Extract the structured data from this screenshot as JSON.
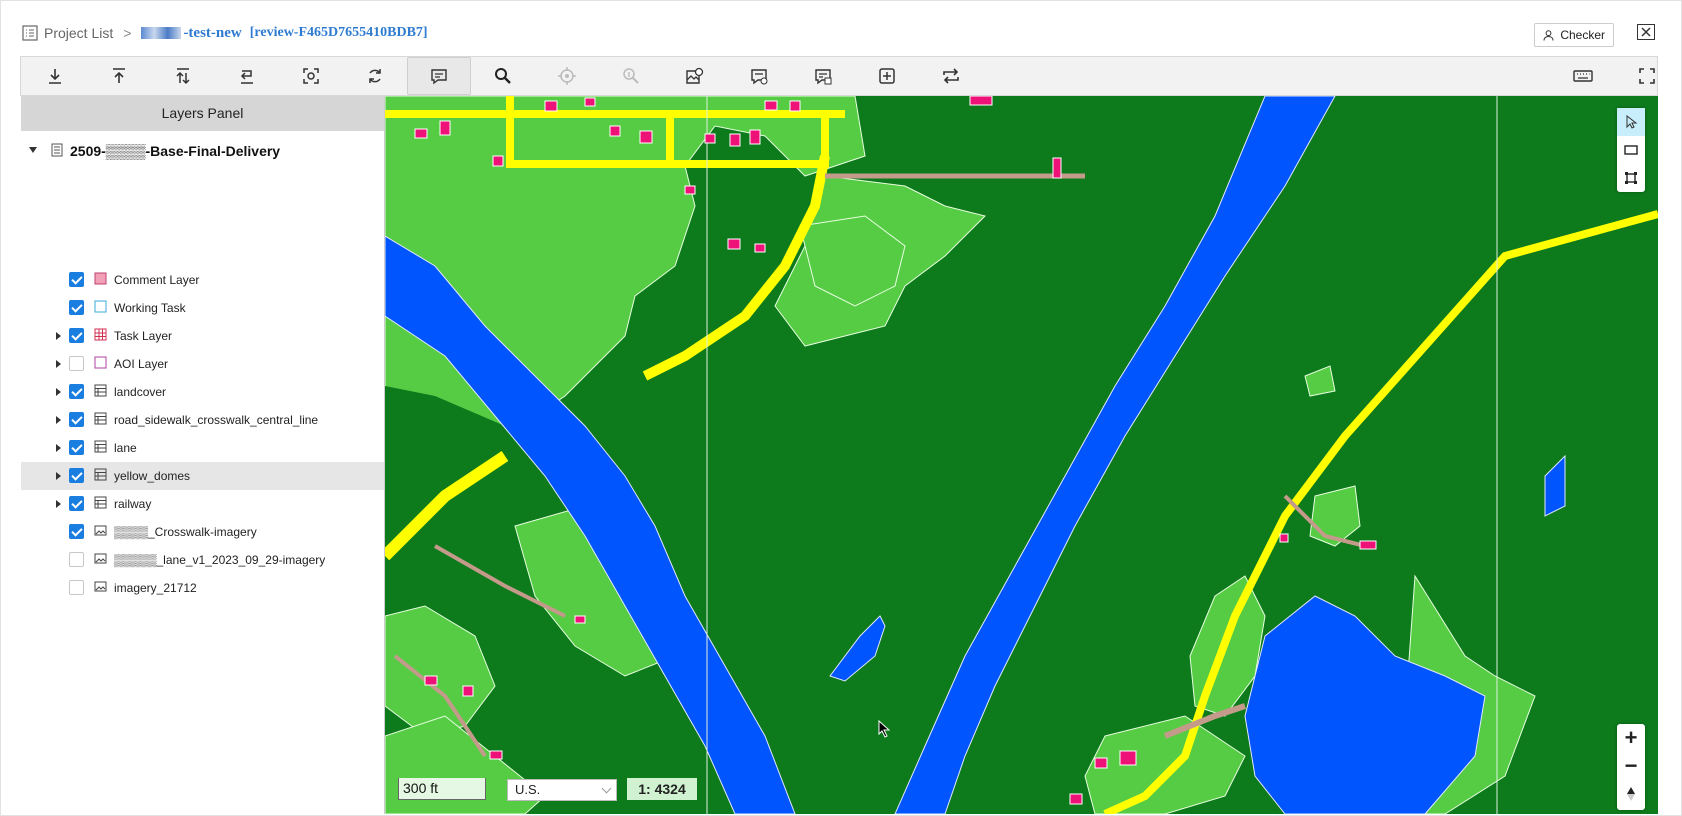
{
  "header": {
    "breadcrumb_root": "Project List",
    "separator": ">",
    "project_name": "-test-new",
    "review_id": "[review-F465D7655410BDB7]",
    "checker_label": "Checker"
  },
  "toolbar": {
    "buttons": [
      "download-icon",
      "upload-icon",
      "upload-all-icon",
      "return-icon",
      "capture-icon",
      "refresh-icon",
      "comment-icon",
      "search-icon",
      "locate-icon",
      "info-icon",
      "map-photo-icon",
      "comment-list-icon",
      "comment-edit-icon",
      "add-box-icon",
      "swap-icon",
      "keyboard-icon",
      "fullscreen-icon"
    ]
  },
  "layers_panel": {
    "title": "Layers Panel",
    "root": "2509-▒▒▒▒-Base-Final-Delivery",
    "items": [
      {
        "label": "Comment Layer",
        "checked": true,
        "expandable": false
      },
      {
        "label": "Working Task",
        "checked": true,
        "expandable": false
      },
      {
        "label": "Task Layer",
        "checked": true,
        "expandable": true
      },
      {
        "label": "AOI Layer",
        "checked": false,
        "expandable": true
      },
      {
        "label": "landcover",
        "checked": true,
        "expandable": true
      },
      {
        "label": "road_sidewalk_crosswalk_central_line",
        "checked": true,
        "expandable": true
      },
      {
        "label": "lane",
        "checked": true,
        "expandable": true
      },
      {
        "label": "yellow_domes",
        "checked": true,
        "expandable": true
      },
      {
        "label": "railway",
        "checked": true,
        "expandable": true
      },
      {
        "label": "▒▒▒▒_Crosswalk-imagery",
        "checked": true,
        "expandable": false
      },
      {
        "label": "▒▒▒▒▒_lane_v1_2023_09_29-imagery",
        "checked": false,
        "expandable": false
      },
      {
        "label": "imagery_21712",
        "checked": false,
        "expandable": false
      }
    ]
  },
  "map": {
    "scale_text": "300 ft",
    "units": "U.S.",
    "ratio": "1: 4324",
    "zoom_in": "+",
    "zoom_out": "−",
    "colors": {
      "forest": "#0d7a1c",
      "grass": "#55cc44",
      "water": "#0055ff",
      "road": "#ffff00",
      "building": "#ee1177",
      "sidewalk": "#c49a8a"
    }
  }
}
